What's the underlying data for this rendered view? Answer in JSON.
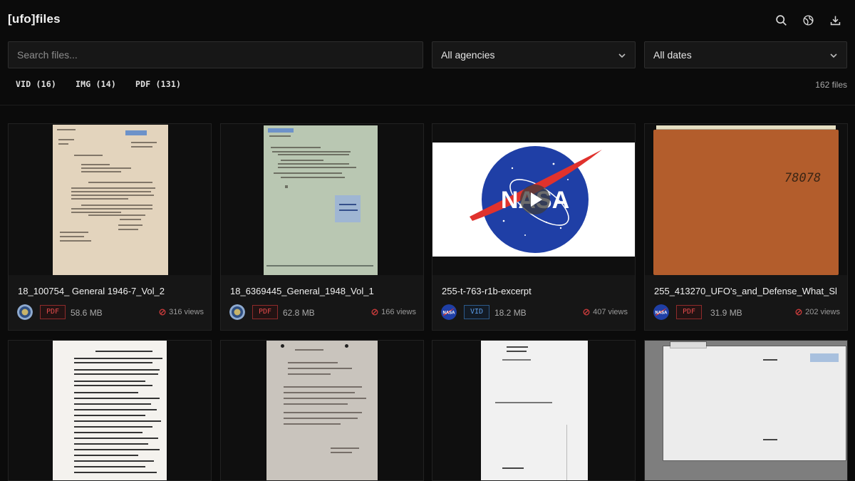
{
  "app": {
    "title": "[ufo]files"
  },
  "header_icons": [
    {
      "name": "search-icon"
    },
    {
      "name": "globe-icon"
    },
    {
      "name": "download-icon"
    }
  ],
  "search": {
    "placeholder": "Search files..."
  },
  "filters": {
    "agency": {
      "value": "All agencies"
    },
    "dates": {
      "value": "All dates"
    }
  },
  "type_chips": [
    "VID (16)",
    "IMG (14)",
    "PDF (131)"
  ],
  "file_count": "162 files",
  "colors": {
    "background": "#0b0b0b",
    "pdf_badge": "#e34b4b",
    "vid_badge": "#5b9de8",
    "views_icon": "#c43a3a"
  },
  "cards": [
    {
      "title": "18_100754_ General 1946-7_Vol_2",
      "type": "PDF",
      "size": "58.6 MB",
      "views": "316 views",
      "agency_icon": "dod-seal-icon"
    },
    {
      "title": "18_6369445_General_1948_Vol_1",
      "type": "PDF",
      "size": "62.8 MB",
      "views": "166 views",
      "agency_icon": "dod-seal-icon"
    },
    {
      "title": "255-t-763-r1b-excerpt",
      "type": "VID",
      "size": "18.2 MB",
      "views": "407 views",
      "agency_icon": "nasa-logo-icon"
    },
    {
      "title": "255_413270_UFO's_and_Defense_What_Sl",
      "type": "PDF",
      "size": "31.9 MB",
      "views": "202 views",
      "agency_icon": "nasa-logo-icon"
    }
  ],
  "thumb_text": {
    "nasa_logo": "NASA",
    "folder_number": "78078"
  }
}
